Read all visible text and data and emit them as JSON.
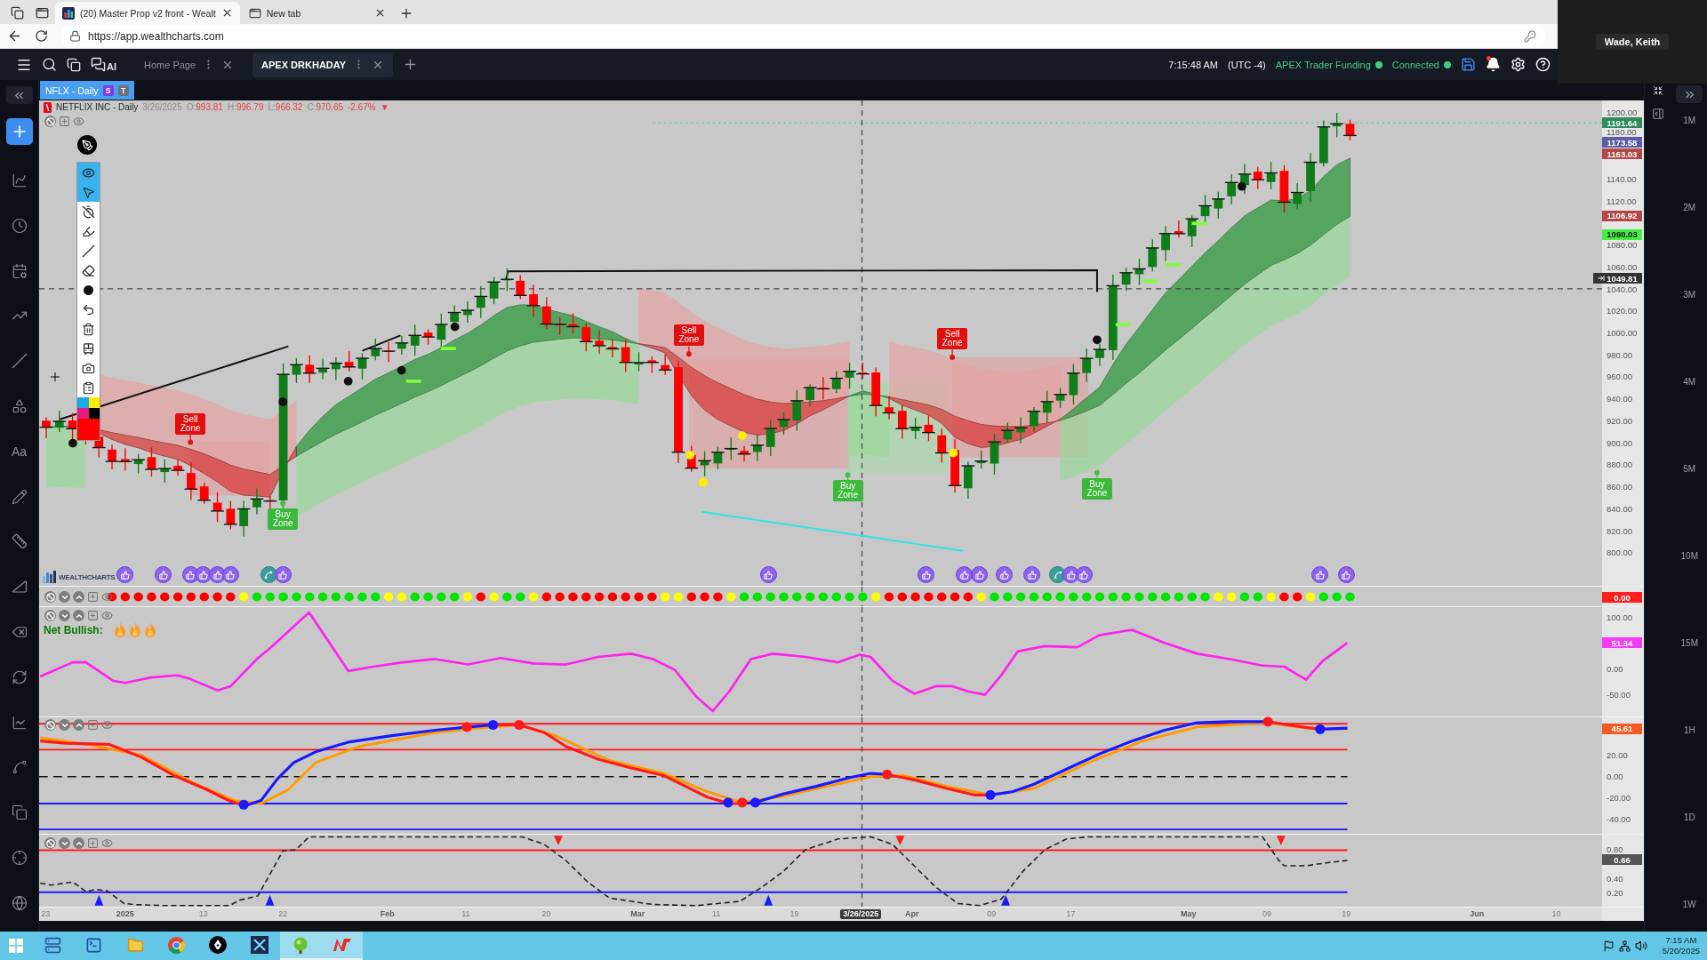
{
  "browser": {
    "tabs": [
      {
        "title": "(20) Master Prop v2 front - Wealt",
        "selected": true
      },
      {
        "title": "New tab",
        "selected": false
      }
    ],
    "url": "https://app.wealthcharts.com"
  },
  "video_tile": {
    "name": "Wade, Keith"
  },
  "app_bar": {
    "ai_label": "AI",
    "tabs": [
      {
        "title": "Home Page",
        "selected": false
      },
      {
        "title": "APEX DRKHADAY",
        "selected": true
      }
    ],
    "clock": "7:15:48 AM",
    "timezone": "(UTC -4)",
    "account": {
      "label": "APEX Trader Funding",
      "color": "#3fcf7f"
    },
    "connection": {
      "label": "Connected",
      "color": "#3fcf7f"
    },
    "notification_unread": true
  },
  "chart_tab": {
    "title": "NFLX - Daily",
    "badges": [
      {
        "label": "S",
        "color": "#7c3aed"
      },
      {
        "label": "T",
        "color": "#6b7280"
      }
    ]
  },
  "left_toolbar": {
    "text_tool": "Aa"
  },
  "price_chart": {
    "header": {
      "name": "NETFLIX INC - Daily",
      "date": "3/26/2025",
      "values": [
        {
          "label": "O:",
          "value": "993.81"
        },
        {
          "label": "H:",
          "value": "996.79"
        },
        {
          "label": "L:",
          "value": "966.32"
        },
        {
          "label": "C:",
          "value": "970.65"
        }
      ],
      "change": "-2.67%",
      "direction": "▼"
    },
    "drawing_tools": [
      {
        "selected": true
      },
      {
        "selected": true
      },
      {
        "selected": false
      },
      {
        "selected": false
      },
      {
        "selected": false
      },
      {
        "selected": false
      },
      {
        "selected": false
      },
      {
        "selected": false
      },
      {
        "selected": false
      },
      {
        "selected": false
      },
      {
        "selected": false
      },
      {
        "selected": false
      }
    ],
    "palette": [
      {
        "color": "#19a7e8"
      },
      {
        "color": "#ffee00"
      },
      {
        "color": "#e8197d"
      },
      {
        "color": "#000000"
      }
    ],
    "current_color": {
      "color": "#ff0000"
    },
    "signals": [
      {
        "kind": "sell",
        "label": "Sell Zone"
      },
      {
        "kind": "buy",
        "label": "Buy Zone"
      },
      {
        "kind": "sell",
        "label": "Sell Zone"
      },
      {
        "kind": "buy",
        "label": "Buy Zone"
      },
      {
        "kind": "sell",
        "label": "Sell Zone"
      },
      {
        "kind": "buy",
        "label": "Buy Zone"
      }
    ],
    "logo": "WEALTHCHARTS",
    "axis": {
      "ticks": [
        "1200.00",
        "1180.00",
        "1140.00",
        "1120.00",
        "1080.00",
        "1060.00",
        "1040.00",
        "1020.00",
        "1000.00",
        "980.00",
        "960.00",
        "940.00",
        "920.00",
        "900.00",
        "880.00",
        "860.00",
        "840.00",
        "820.00",
        "800.00"
      ],
      "badges": [
        {
          "text": "1191.64",
          "color": "#2e8b5a",
          "kind": "level"
        },
        {
          "text": "1173.58",
          "color": "#5b5ca8",
          "kind": "level"
        },
        {
          "text": "1163.03",
          "color": "#b04848",
          "kind": "level"
        },
        {
          "text": "1106.92",
          "color": "#b04848",
          "kind": "level"
        },
        {
          "text": "1090.03",
          "color": "#44ee44",
          "kind": "level"
        },
        {
          "text": "1049.81",
          "color": "#333333",
          "kind": "cursor"
        }
      ]
    }
  },
  "signal_dots": {
    "dots": [
      {
        "color": "#ff0000"
      },
      {
        "color": "#ff0000"
      },
      {
        "color": "#ff0000"
      },
      {
        "color": "#ff0000"
      },
      {
        "color": "#ff0000"
      },
      {
        "color": "#ff0000"
      },
      {
        "color": "#ff0000"
      },
      {
        "color": "#ff0000"
      },
      {
        "color": "#ff0000"
      },
      {
        "color": "#ff0000"
      },
      {
        "color": "#ffff00"
      },
      {
        "color": "#00e600"
      },
      {
        "color": "#00e600"
      },
      {
        "color": "#00e600"
      },
      {
        "color": "#00e600"
      },
      {
        "color": "#00e600"
      },
      {
        "color": "#00e600"
      },
      {
        "color": "#00e600"
      },
      {
        "color": "#00e600"
      },
      {
        "color": "#00e600"
      },
      {
        "color": "#00e600"
      },
      {
        "color": "#ffff00"
      },
      {
        "color": "#ffff00"
      },
      {
        "color": "#00e600"
      },
      {
        "color": "#00e600"
      },
      {
        "color": "#00e600"
      },
      {
        "color": "#00e600"
      },
      {
        "color": "#ffff00"
      },
      {
        "color": "#ff0000"
      },
      {
        "color": "#ffff00"
      },
      {
        "color": "#00e600"
      },
      {
        "color": "#00e600"
      },
      {
        "color": "#ffff00"
      },
      {
        "color": "#ff0000"
      },
      {
        "color": "#ff0000"
      },
      {
        "color": "#ff0000"
      },
      {
        "color": "#ff0000"
      },
      {
        "color": "#ff0000"
      },
      {
        "color": "#ff0000"
      },
      {
        "color": "#ff0000"
      },
      {
        "color": "#ff0000"
      },
      {
        "color": "#ff0000"
      },
      {
        "color": "#ffff00"
      },
      {
        "color": "#ffff00"
      },
      {
        "color": "#ff0000"
      },
      {
        "color": "#ff0000"
      },
      {
        "color": "#ff0000"
      },
      {
        "color": "#ffff00"
      },
      {
        "color": "#00e600"
      },
      {
        "color": "#00e600"
      },
      {
        "color": "#00e600"
      },
      {
        "color": "#00e600"
      },
      {
        "color": "#00e600"
      },
      {
        "color": "#00e600"
      },
      {
        "color": "#00e600"
      },
      {
        "color": "#00e600"
      },
      {
        "color": "#00e600"
      },
      {
        "color": "#00e600"
      },
      {
        "color": "#ffff00"
      },
      {
        "color": "#ff0000"
      },
      {
        "color": "#ff0000"
      },
      {
        "color": "#ff0000"
      },
      {
        "color": "#ff0000"
      },
      {
        "color": "#ff0000"
      },
      {
        "color": "#ff0000"
      },
      {
        "color": "#ff0000"
      },
      {
        "color": "#ffff00"
      },
      {
        "color": "#00e600"
      },
      {
        "color": "#00e600"
      },
      {
        "color": "#00e600"
      },
      {
        "color": "#00e600"
      },
      {
        "color": "#00e600"
      },
      {
        "color": "#00e600"
      },
      {
        "color": "#00e600"
      },
      {
        "color": "#00e600"
      },
      {
        "color": "#00e600"
      },
      {
        "color": "#00e600"
      },
      {
        "color": "#00e600"
      },
      {
        "color": "#00e600"
      },
      {
        "color": "#00e600"
      },
      {
        "color": "#00e600"
      },
      {
        "color": "#00e600"
      },
      {
        "color": "#00e600"
      },
      {
        "color": "#00e600"
      },
      {
        "color": "#ffff00"
      },
      {
        "color": "#ffff00"
      },
      {
        "color": "#00e600"
      },
      {
        "color": "#00e600"
      },
      {
        "color": "#ffff00"
      },
      {
        "color": "#ff0000"
      },
      {
        "color": "#ff0000"
      },
      {
        "color": "#ffff00"
      },
      {
        "color": "#00e600"
      },
      {
        "color": "#00e600"
      },
      {
        "color": "#00e600"
      }
    ],
    "axis": {
      "badges": [
        {
          "text": "0.00",
          "color": "#ff1f1f",
          "kind": "level"
        }
      ]
    }
  },
  "momentum_panel": {
    "label": "Net Bullish:",
    "stars": 3,
    "axis": {
      "ticks": [
        "100.00",
        "0.00",
        "-50.00"
      ],
      "badges": [
        {
          "text": "51.34",
          "color": "#f53cf5",
          "kind": "level"
        }
      ]
    }
  },
  "oscillator_panel": {
    "axis": {
      "ticks": [
        "20.00",
        "0.00",
        "-20.00",
        "-40.00"
      ],
      "badges": [
        {
          "text": "45.61",
          "color": "#f55a23",
          "kind": "level"
        }
      ]
    }
  },
  "cycle_panel": {
    "axis": {
      "ticks": [
        "0.80",
        "0.40",
        "0.20"
      ],
      "badges": [
        {
          "text": "0.66",
          "color": "#555555",
          "kind": "level"
        }
      ]
    }
  },
  "time_axis": [
    {
      "label": "23",
      "kind": "day"
    },
    {
      "label": "2025",
      "kind": "major"
    },
    {
      "label": "13",
      "kind": "day"
    },
    {
      "label": "22",
      "kind": "day"
    },
    {
      "label": "Feb",
      "kind": "major"
    },
    {
      "label": "11",
      "kind": "day"
    },
    {
      "label": "20",
      "kind": "day"
    },
    {
      "label": "Mar",
      "kind": "major"
    },
    {
      "label": "11",
      "kind": "day"
    },
    {
      "label": "19",
      "kind": "day"
    },
    {
      "label": "3/26/2025",
      "kind": "cursor"
    },
    {
      "label": "Apr",
      "kind": "major"
    },
    {
      "label": "09",
      "kind": "day"
    },
    {
      "label": "17",
      "kind": "day"
    },
    {
      "label": "May",
      "kind": "major"
    },
    {
      "label": "09",
      "kind": "day"
    },
    {
      "label": "19",
      "kind": "day"
    },
    {
      "label": "Jun",
      "kind": "major"
    },
    {
      "label": "10",
      "kind": "day"
    }
  ],
  "timeframes": [
    "1M",
    "2M",
    "3M",
    "4M",
    "5M",
    "10M",
    "15M",
    "1H",
    "1D",
    "1W"
  ],
  "taskbar": {
    "apps": [
      {
        "selected": false
      },
      {
        "selected": false
      },
      {
        "selected": false
      },
      {
        "selected": false
      },
      {
        "selected": false
      },
      {
        "selected": false
      },
      {
        "selected": true
      },
      {
        "selected": true
      }
    ],
    "time": "7:15 AM",
    "date": "5/20/2025"
  }
}
